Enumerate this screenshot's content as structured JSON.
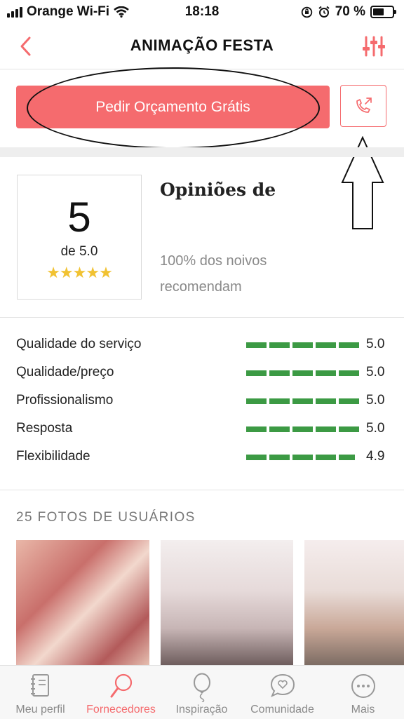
{
  "status_bar": {
    "carrier": "Orange Wi-Fi",
    "time": "18:18",
    "battery": "70 %",
    "battery_level": 0.7
  },
  "nav": {
    "title": "ANIMAÇÃO FESTA",
    "back_icon": "chevron-left-icon",
    "filter_icon": "sliders-icon"
  },
  "cta": {
    "quote_label": "Pedir Orçamento Grátis",
    "call_icon": "phone-outgoing-icon"
  },
  "rating": {
    "score": "5",
    "out_of": "de 5.0",
    "stars": 5,
    "stars_text": "★★★★★"
  },
  "reviews": {
    "title": "Opiniões de",
    "recommend_text": "100% dos noivos recomendam"
  },
  "scores": [
    {
      "label": "Qualidade do serviço",
      "value": "5.0"
    },
    {
      "label": "Qualidade/preço",
      "value": "5.0"
    },
    {
      "label": "Profissionalismo",
      "value": "5.0"
    },
    {
      "label": "Resposta",
      "value": "5.0"
    },
    {
      "label": "Flexibilidade",
      "value": "4.9"
    }
  ],
  "photos": {
    "title": "25 FOTOS DE USUÁRIOS"
  },
  "tabbar": {
    "items": [
      {
        "label": "Meu perfil",
        "icon": "notebook-icon"
      },
      {
        "label": "Fornecedores",
        "icon": "search-icon",
        "active": true
      },
      {
        "label": "Inspiração",
        "icon": "balloon-icon"
      },
      {
        "label": "Comunidade",
        "icon": "chat-heart-icon"
      },
      {
        "label": "Mais",
        "icon": "more-icon"
      }
    ]
  },
  "colors": {
    "accent": "#f56b6e",
    "score_bar": "#3c9a44",
    "star": "#f1c232"
  }
}
